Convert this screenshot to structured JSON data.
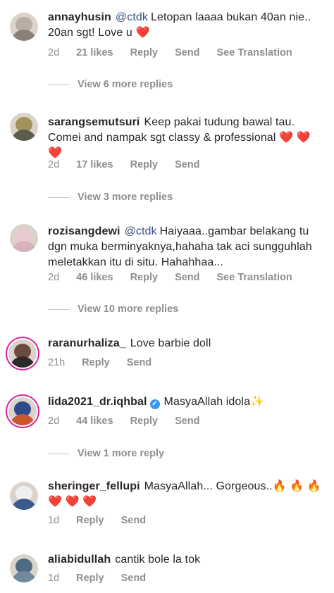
{
  "comments": [
    {
      "username": "annayhusin",
      "mention": "@ctdk",
      "text": "Letopan laaaa bukan 40an nie.. 20an sgt! Love u ❤️",
      "time": "2d",
      "likes": "21 likes",
      "reply": "Reply",
      "send": "Send",
      "translate": "See Translation",
      "more": "View 6 more replies"
    },
    {
      "username": "sarangsemutsuri",
      "text": "Keep pakai tudung bawal tau. Comei and nampak sgt classy & professional ❤️ ❤️ ❤️",
      "time": "2d",
      "likes": "17 likes",
      "reply": "Reply",
      "send": "Send",
      "more": "View 3 more replies"
    },
    {
      "username": "rozisangdewi",
      "mention": "@ctdk",
      "text": "Haiyaaa..gambar belakang tu dgn muka berminyaknya,hahaha tak aci sungguhlah meletakkan itu di situ. Hahahhaa...",
      "time": "2d",
      "likes": "46 likes",
      "reply": "Reply",
      "send": "Send",
      "translate": "See Translation",
      "more": "View 10 more replies"
    },
    {
      "username": "raranurhaliza_",
      "text": "Love barbie doll",
      "time": "21h",
      "reply": "Reply",
      "send": "Send"
    },
    {
      "username": "lida2021_dr.iqhbal",
      "text": "MasyaAllah idola✨",
      "time": "2d",
      "likes": "44 likes",
      "reply": "Reply",
      "send": "Send",
      "more": "View 1 more reply"
    },
    {
      "username": "sheringer_fellupi",
      "text": "MasyaAllah... Gorgeous..🔥 🔥 🔥 ❤️ ❤️ ❤️",
      "time": "1d",
      "reply": "Reply",
      "send": "Send"
    },
    {
      "username": "aliabidullah",
      "text": "cantik bole la tok",
      "time": "1d",
      "reply": "Reply",
      "send": "Send"
    }
  ]
}
